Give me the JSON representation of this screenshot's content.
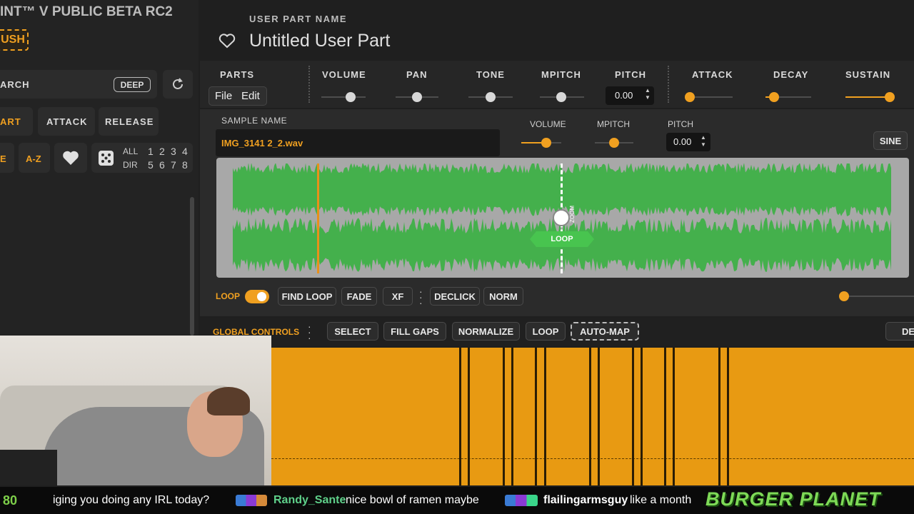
{
  "app": {
    "title_partial": "INT™ V PUBLIC BETA RC2",
    "push_label": "USH"
  },
  "part": {
    "name_label": "USER PART NAME",
    "name": "Untitled User Part"
  },
  "browser": {
    "search_partial": "ARCH",
    "deep_label": "DEEP",
    "tabs": [
      "ART",
      "ATTACK",
      "RELEASE"
    ],
    "filter_partial": "E",
    "sort_label": "A-Z",
    "all_label": "ALL",
    "dir_label": "DIR",
    "slots_top": [
      "1",
      "2",
      "3",
      "4"
    ],
    "slots_bottom": [
      "5",
      "6",
      "7",
      "8"
    ]
  },
  "params": {
    "parts_label": "PARTS",
    "file_label": "File",
    "edit_label": "Edit",
    "volume": "VOLUME",
    "pan": "PAN",
    "tone": "TONE",
    "mpitch": "MPITCH",
    "pitch": "PITCH",
    "pitch_value": "0.00",
    "attack": "ATTACK",
    "decay": "DECAY",
    "sustain": "SUSTAIN"
  },
  "sample": {
    "name_label": "SAMPLE NAME",
    "name": "IMG_3141 2_2.wav",
    "volume": "VOLUME",
    "mpitch": "MPITCH",
    "pitch": "PITCH",
    "pitch_value": "0.00",
    "wave_shape": "SINE",
    "loop_marker": "LOOP",
    "zoom_label": "ZOOM"
  },
  "sample_toolbar": {
    "loop_label": "LOOP",
    "find_loop": "FIND LOOP",
    "fade": "FADE",
    "xf": "XF",
    "declick": "DECLICK",
    "norm": "NORM"
  },
  "global": {
    "label": "GLOBAL CONTROLS",
    "select": "SELECT",
    "fill_gaps": "FILL GAPS",
    "normalize": "NORMALIZE",
    "loop": "LOOP",
    "auto_map": "AUTO-MAP",
    "right_partial": "DE"
  },
  "ticker": {
    "left_number": "80",
    "msg1": "iging you doing any IRL today?",
    "user2": "Randy_Sante",
    "msg2": "nice bowl of ramen maybe",
    "user3": "flailingarmsguy",
    "msg3": "like a month",
    "logo": "BURGER PLANET"
  },
  "colors": {
    "accent": "#f0a020",
    "wave": "#44b04c",
    "bg": "#1f1f1f"
  }
}
